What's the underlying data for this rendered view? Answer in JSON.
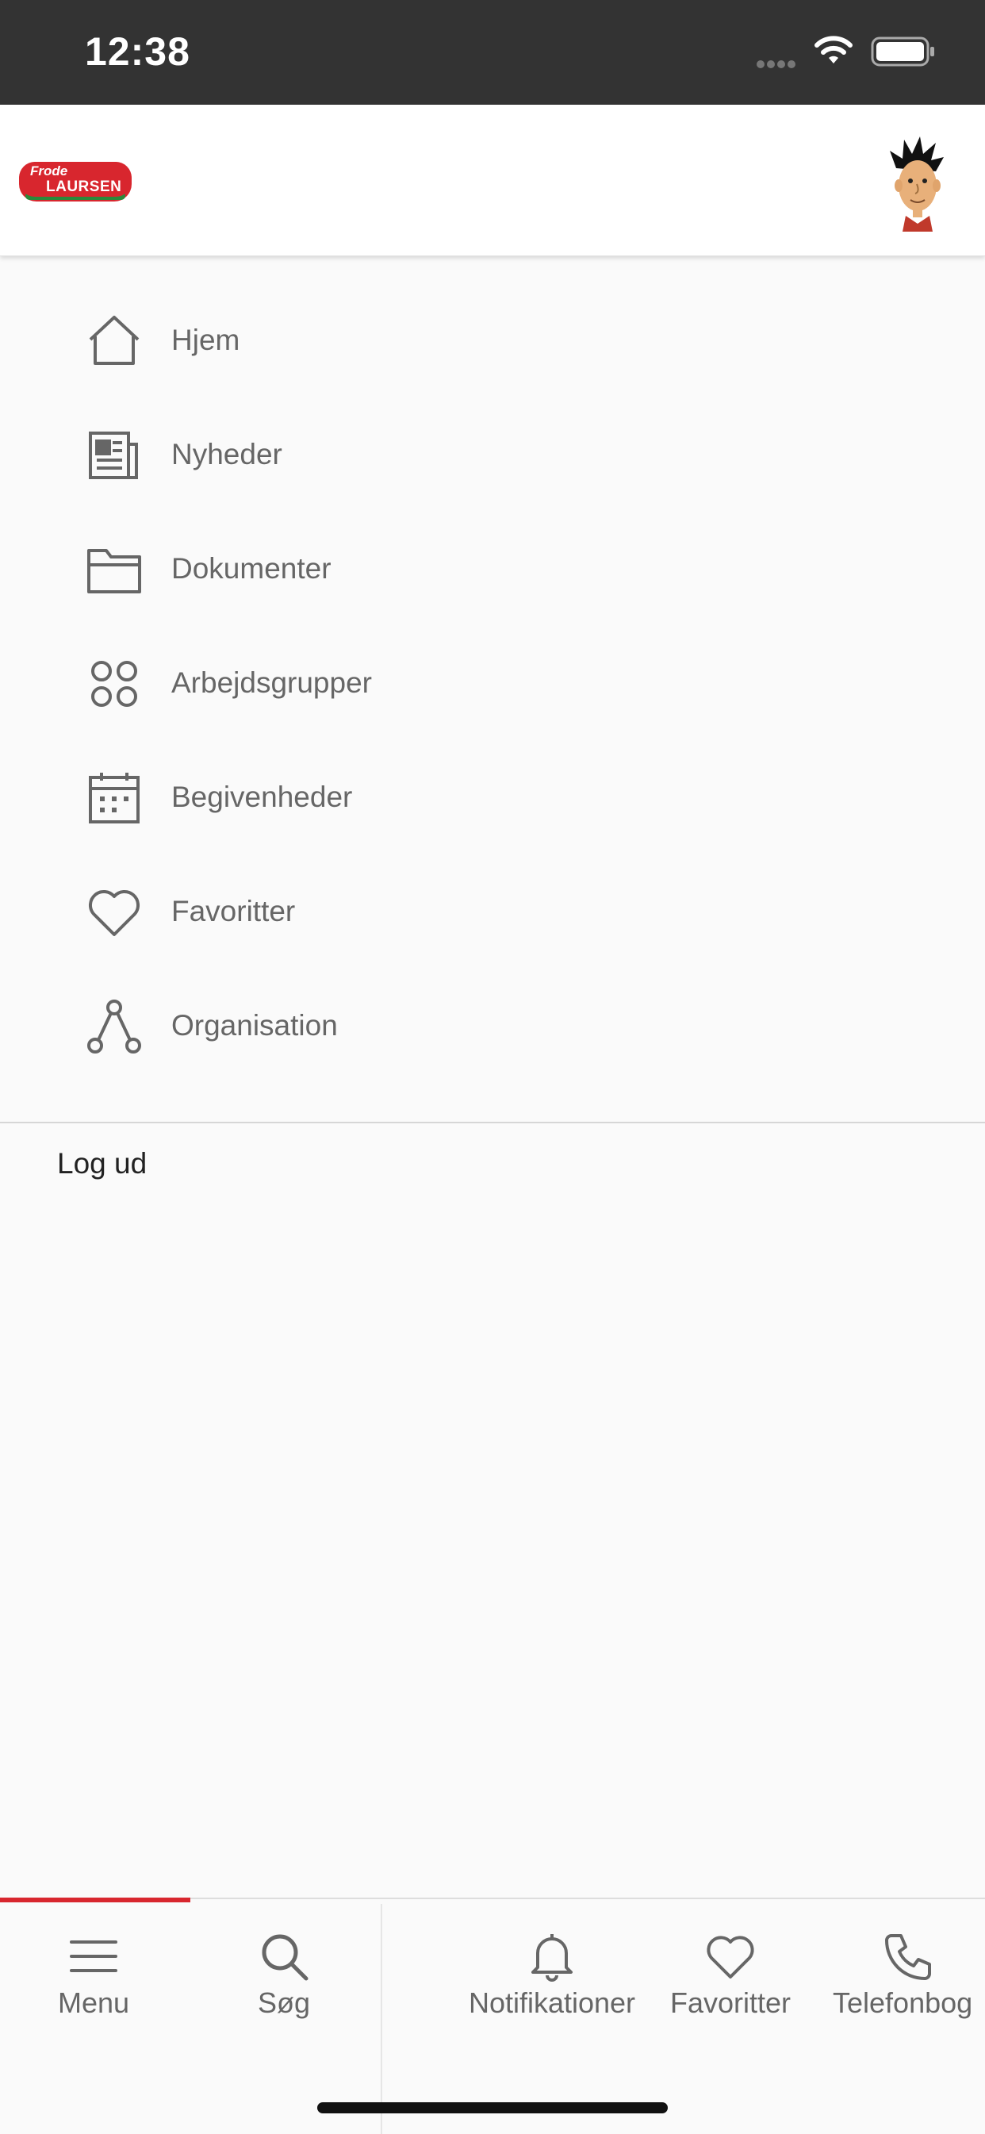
{
  "status_bar": {
    "time": "12:38"
  },
  "header": {
    "logo_line1": "Frode",
    "logo_line2": "LAURSEN"
  },
  "menu": {
    "items": [
      {
        "label": "Hjem",
        "icon": "home-icon"
      },
      {
        "label": "Nyheder",
        "icon": "newspaper-icon"
      },
      {
        "label": "Dokumenter",
        "icon": "folder-icon"
      },
      {
        "label": "Arbejdsgrupper",
        "icon": "groups-icon"
      },
      {
        "label": "Begivenheder",
        "icon": "calendar-icon"
      },
      {
        "label": "Favoritter",
        "icon": "heart-icon"
      },
      {
        "label": "Organisation",
        "icon": "organisation-icon"
      }
    ],
    "logout": "Log ud"
  },
  "bottom_nav": {
    "items": [
      {
        "label": "Menu",
        "icon": "hamburger-icon"
      },
      {
        "label": "Søg",
        "icon": "search-icon"
      },
      {
        "label": "Notifikationer",
        "icon": "bell-icon"
      },
      {
        "label": "Favoritter",
        "icon": "heart-icon"
      },
      {
        "label": "Telefonbog",
        "icon": "phone-icon"
      }
    ],
    "active_index": 0
  },
  "colors": {
    "accent": "#d8262e",
    "status_bar": "#333333",
    "icon_gray": "#666666"
  }
}
